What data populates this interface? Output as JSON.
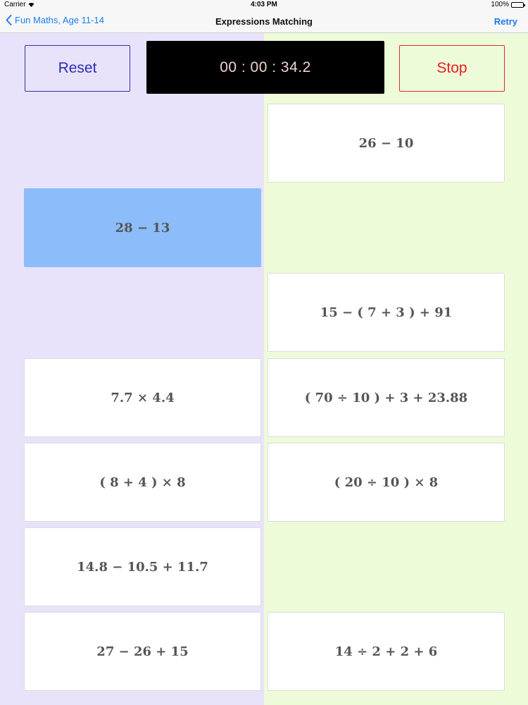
{
  "status_bar": {
    "carrier": "Carrier",
    "time": "4:03 PM",
    "battery": "100%"
  },
  "nav": {
    "back_label": "Fun Maths, Age 11-14",
    "title": "Expressions Matching",
    "retry_label": "Retry"
  },
  "controls": {
    "reset_label": "Reset",
    "timer": "00 : 00 : 34.2",
    "stop_label": "Stop"
  },
  "left_cards": [
    {
      "expression": "28 − 13",
      "selected": true
    },
    {
      "expression": "7.7 × 4.4"
    },
    {
      "expression": "( 8 + 4 ) × 8"
    },
    {
      "expression": "14.8 − 10.5 + 11.7"
    },
    {
      "expression": "27 − 26 + 15"
    }
  ],
  "right_cards": [
    {
      "expression": "26 − 10"
    },
    {
      "expression": "15 − ( 7 + 3 ) + 91"
    },
    {
      "expression": "( 70 ÷ 10 ) + 3 + 23.88"
    },
    {
      "expression": "( 20 ÷ 10 ) × 8"
    },
    {
      "expression": "14 ÷ 2 + 2 + 6"
    }
  ],
  "colors": {
    "left_column_bg": "#e8e3fb",
    "right_column_bg": "#eefbd9",
    "selected_card": "#8dbcfb",
    "accent_blue": "#1a7cf2",
    "reset_text": "#2b2bb4",
    "stop_text": "#e51f1f"
  },
  "icons": {
    "back": "chevron-left-icon",
    "wifi": "wifi-icon",
    "battery": "battery-icon"
  }
}
